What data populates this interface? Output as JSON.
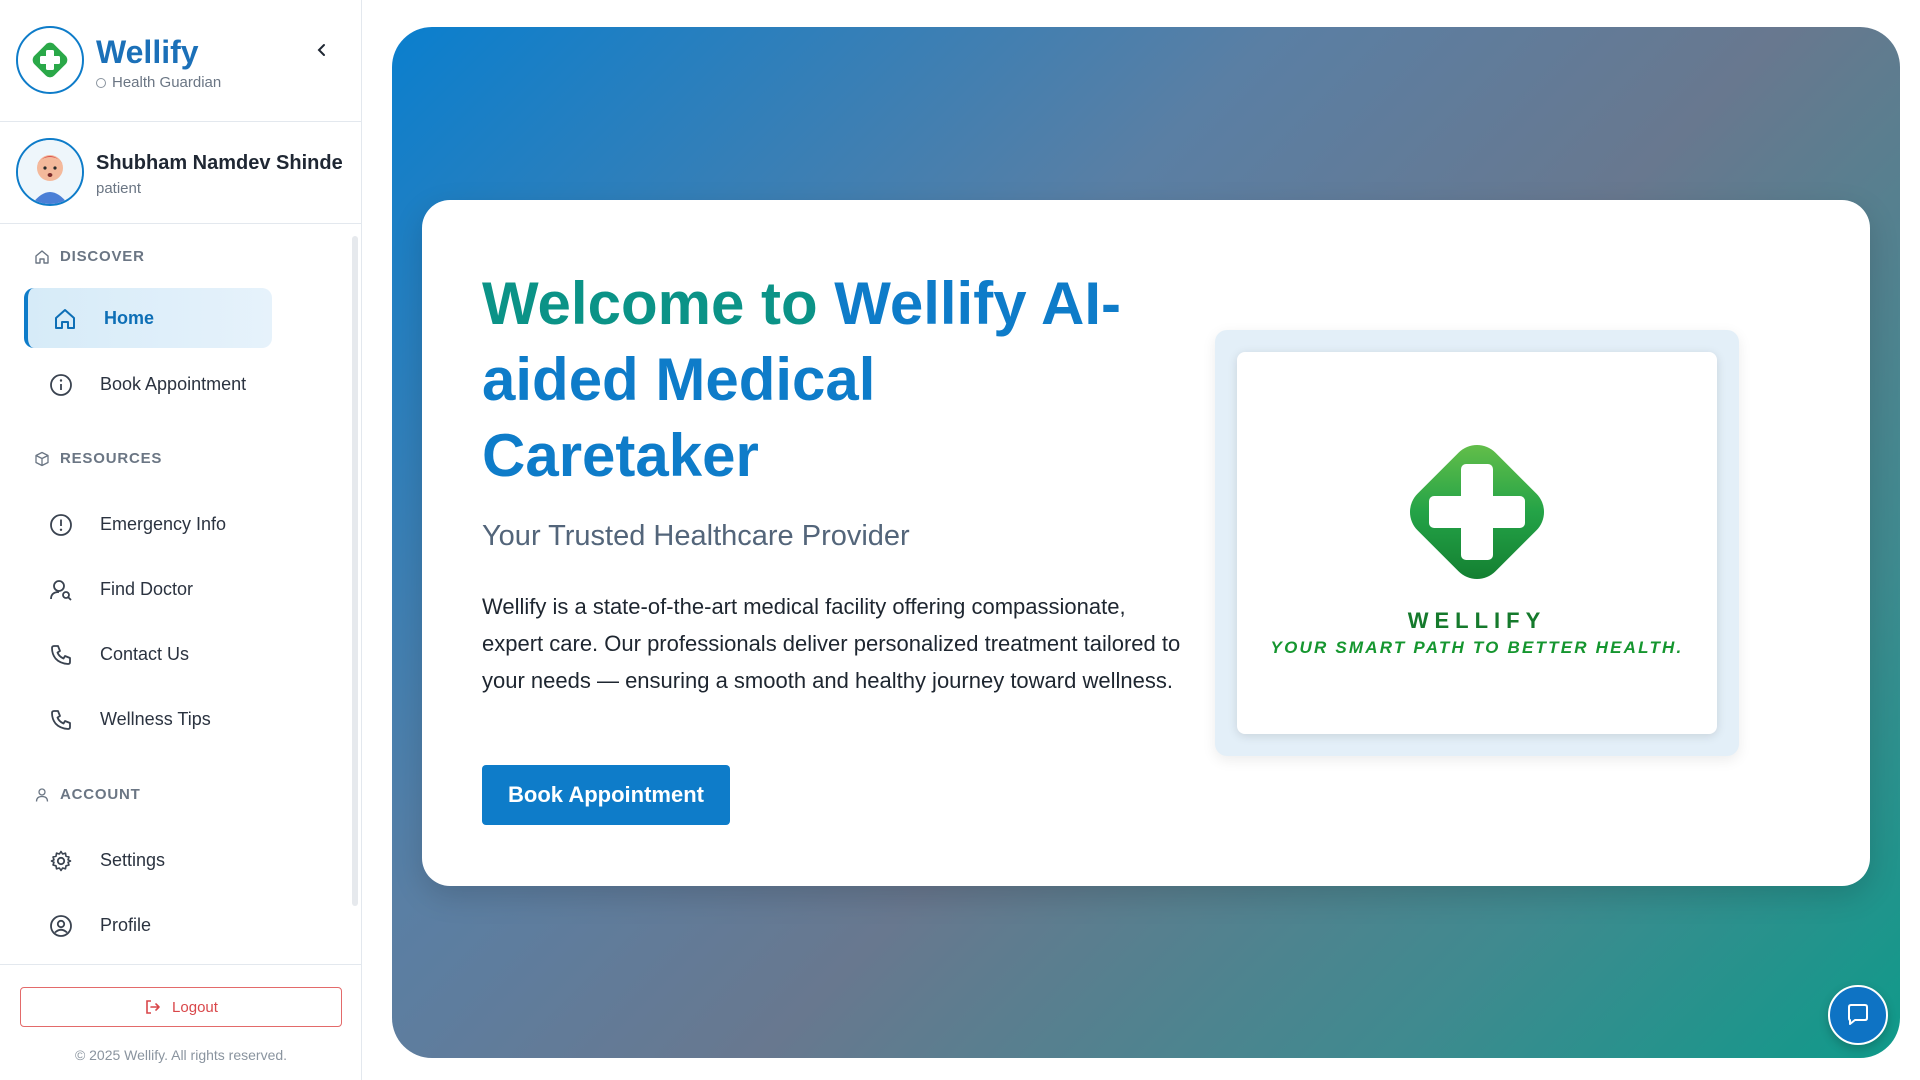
{
  "brand": {
    "name": "Wellify",
    "subtitle": "Health Guardian",
    "logo_icon": "medical-cross-icon"
  },
  "user": {
    "name": "Shubham Namdev Shinde",
    "role": "patient"
  },
  "nav": {
    "sections": [
      {
        "title": "DISCOVER",
        "icon": "home-icon"
      },
      {
        "title": "RESOURCES",
        "icon": "cube-icon"
      },
      {
        "title": "ACCOUNT",
        "icon": "user-icon"
      }
    ],
    "items": [
      {
        "label": "Home",
        "icon": "home-icon",
        "active": true
      },
      {
        "label": "Book Appointment",
        "icon": "info-icon"
      },
      {
        "label": "Emergency Info",
        "icon": "alert-icon"
      },
      {
        "label": "Find Doctor",
        "icon": "user-search-icon"
      },
      {
        "label": "Contact Us",
        "icon": "phone-icon"
      },
      {
        "label": "Wellness Tips",
        "icon": "phone-icon"
      },
      {
        "label": "Settings",
        "icon": "gear-icon"
      },
      {
        "label": "Profile",
        "icon": "user-circle-icon"
      }
    ]
  },
  "footer": {
    "logout_label": "Logout",
    "copyright": "© 2025 Wellify. All rights reserved."
  },
  "hero": {
    "title_part1": "Welcome to",
    "title_part2": "Wellify AI-aided Medical Caretaker",
    "subtitle": "Your Trusted Healthcare Provider",
    "description": "Wellify is a state-of-the-art medical facility offering compassionate, expert care. Our professionals deliver personalized treatment tailored to your needs — ensuring a smooth and healthy journey toward wellness.",
    "cta_label": "Book Appointment",
    "logo_word": "WELLIFY",
    "logo_tagline": "YOUR SMART PATH TO BETTER HEALTH."
  },
  "colors": {
    "primary": "#0e7cc9",
    "teal": "#0b9387",
    "danger": "#d9474a"
  }
}
